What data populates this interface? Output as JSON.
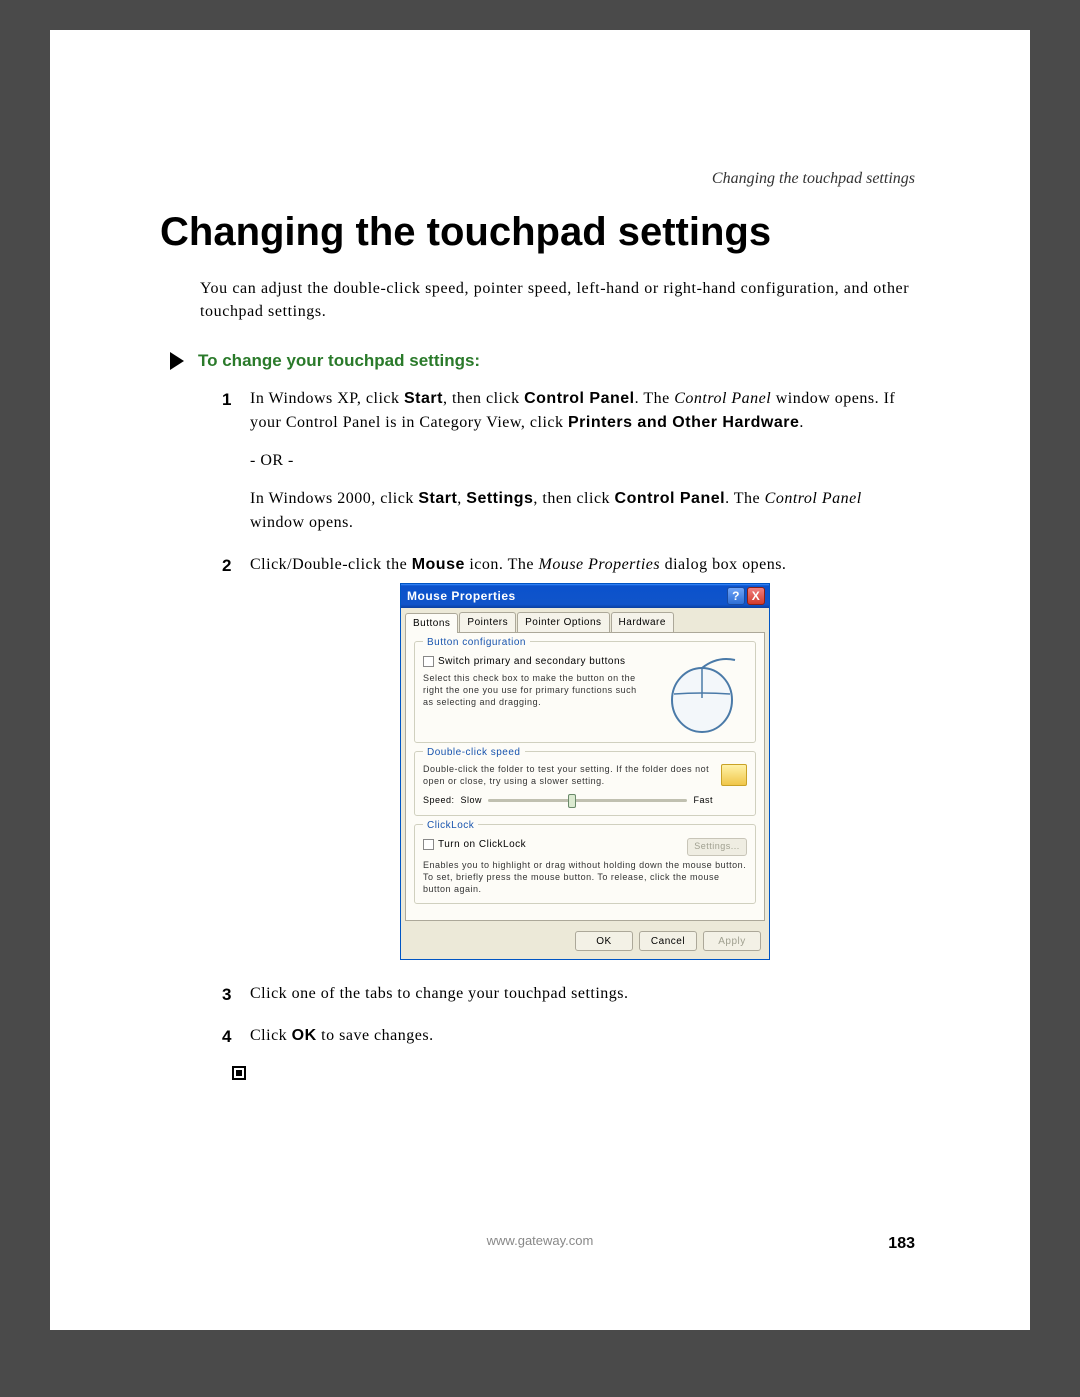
{
  "running_head": "Changing the touchpad settings",
  "heading": "Changing the touchpad settings",
  "intro": "You can adjust the double-click speed, pointer speed, left-hand or right-hand configuration, and other touchpad settings.",
  "sub_heading": "To change your touchpad settings:",
  "step1": {
    "pre": "In Windows XP, click ",
    "b1": "Start",
    "mid1": ", then click ",
    "b2": "Control Panel",
    "mid2": ". The ",
    "i1": "Control Panel",
    "mid3": " window opens. If your Control Panel is in Category View, click ",
    "b3": "Printers and Other Hardware",
    "end": ".",
    "or": "- OR -",
    "w2k_pre": "In Windows 2000, click ",
    "w2k_b1": "Start",
    "w2k_mid1": ", ",
    "w2k_b2": "Settings",
    "w2k_mid2": ", then click ",
    "w2k_b3": "Control Panel",
    "w2k_mid3": ". The ",
    "w2k_i1": "Control Panel",
    "w2k_end": " window opens."
  },
  "step2": {
    "pre": "Click/Double-click the ",
    "b1": "Mouse",
    "mid": " icon. The ",
    "i1": "Mouse Properties",
    "end": " dialog box opens."
  },
  "step3": "Click one of the tabs to change your touchpad settings.",
  "step4": {
    "pre": "Click ",
    "b1": "OK",
    "end": " to save changes."
  },
  "dialog": {
    "title": "Mouse Properties",
    "help": "?",
    "close": "X",
    "tabs": [
      "Buttons",
      "Pointers",
      "Pointer Options",
      "Hardware"
    ],
    "grp1_title": "Button configuration",
    "grp1_chk": "Switch primary and secondary buttons",
    "grp1_desc": "Select this check box to make the button on the right the one you use for primary functions such as selecting and dragging.",
    "grp2_title": "Double-click speed",
    "grp2_desc": "Double-click the folder to test your setting. If the folder does not open or close, try using a slower setting.",
    "speed_label": "Speed:",
    "slow": "Slow",
    "fast": "Fast",
    "grp3_title": "ClickLock",
    "grp3_chk": "Turn on ClickLock",
    "grp3_settings": "Settings...",
    "grp3_desc": "Enables you to highlight or drag without holding down the mouse button. To set, briefly press the mouse button. To release, click the mouse button again.",
    "ok": "OK",
    "cancel": "Cancel",
    "apply": "Apply"
  },
  "footer_url": "www.gateway.com",
  "page_number": "183"
}
